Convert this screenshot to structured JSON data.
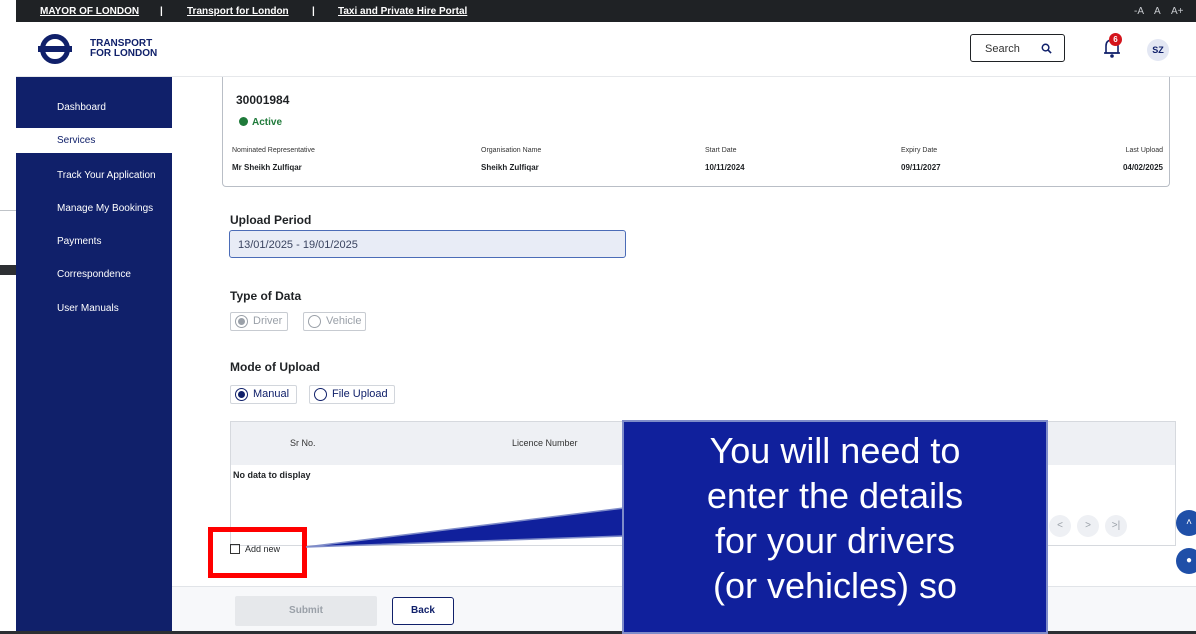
{
  "topbar": {
    "link1": "MAYOR OF LONDON",
    "link2": "Transport for London",
    "link3": "Taxi and Private Hire Portal",
    "sep": "|",
    "font_small": "-A",
    "font_normal": "A",
    "font_large": "A+"
  },
  "header": {
    "logo_line1": "TRANSPORT",
    "logo_line2": "FOR LONDON",
    "search_label": "Search",
    "notification_count": "6",
    "avatar_initials": "SZ"
  },
  "sidebar": {
    "items": [
      {
        "label": "Dashboard"
      },
      {
        "label": "Services"
      },
      {
        "label": "Track Your Application"
      },
      {
        "label": "Manage My Bookings"
      },
      {
        "label": "Payments"
      },
      {
        "label": "Correspondence"
      },
      {
        "label": "User Manuals"
      }
    ],
    "active": "Services"
  },
  "card": {
    "reference": "30001984",
    "status": "Active",
    "columns": [
      {
        "header": "Nominated Representative",
        "value": "Mr Sheikh Zulfiqar"
      },
      {
        "header": "Organisation Name",
        "value": "Sheikh Zulfiqar"
      },
      {
        "header": "Start Date",
        "value": "10/11/2024"
      },
      {
        "header": "Expiry Date",
        "value": "09/11/2027"
      },
      {
        "header": "Last Upload",
        "value": "04/02/2025"
      }
    ]
  },
  "form": {
    "upload_period_label": "Upload Period",
    "upload_period_value": "13/01/2025 - 19/01/2025",
    "type_label": "Type of Data",
    "type_driver": "Driver",
    "type_vehicle": "Vehicle",
    "mode_label": "Mode of Upload",
    "mode_manual": "Manual",
    "mode_file": "File Upload"
  },
  "table": {
    "headers": [
      "Sr No.",
      "Licence Number"
    ],
    "empty_message": "No data to display",
    "pager": [
      "|<",
      "<",
      ">",
      ">|"
    ]
  },
  "add_new_label": "Add new",
  "buttons": {
    "submit": "Submit",
    "back": "Back"
  },
  "callout": {
    "line1": "You will need to",
    "line2": "enter the details",
    "line3": "for your drivers",
    "line4": "(or vehicles) so"
  },
  "icons": {
    "search": "search-icon",
    "bell": "bell-icon",
    "scroll_up": "double-chevron-up-icon",
    "chat": "chat-icon"
  },
  "colors": {
    "brand": "#10206a",
    "active_status": "#1f7a3a",
    "notification": "#d4141c",
    "highlight": "#ff0000",
    "callout_bg": "#10209c"
  }
}
